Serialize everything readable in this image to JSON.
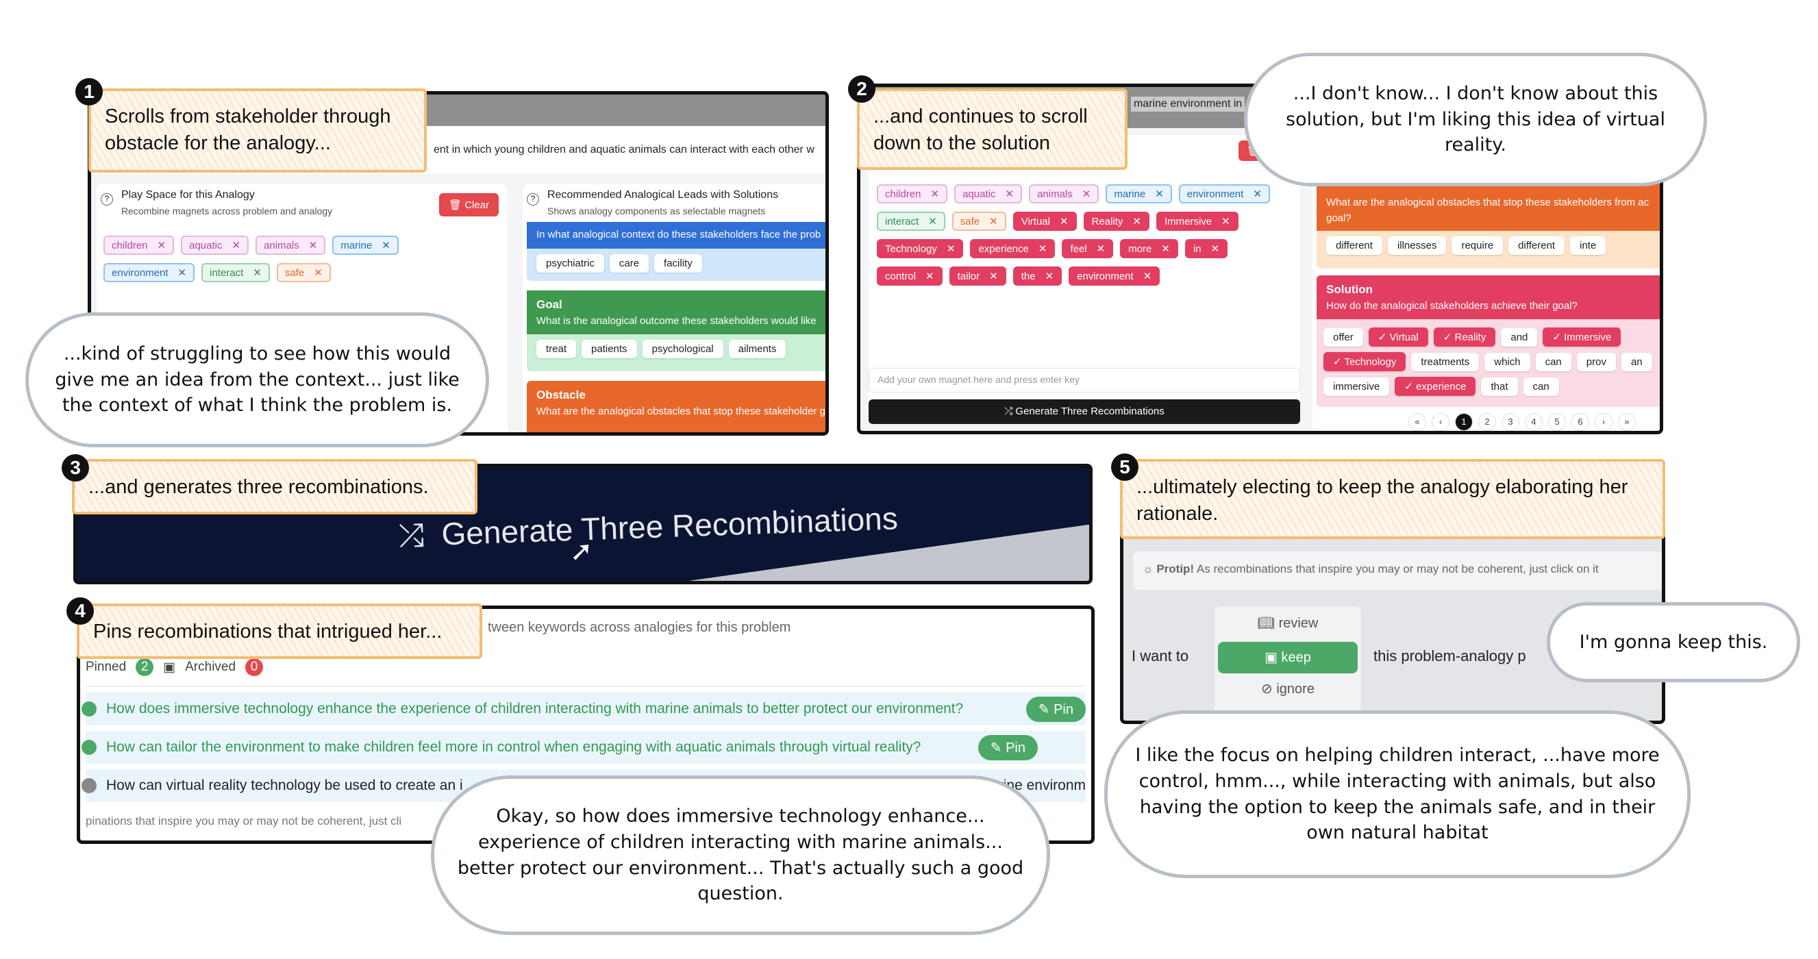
{
  "steps": [
    {
      "number": "1",
      "caption": "Scrolls from stakeholder through obstacle for the analogy..."
    },
    {
      "number": "2",
      "caption": "...and  continues to scroll down to the solution"
    },
    {
      "number": "3",
      "caption": "...and  generates three recombinations."
    },
    {
      "number": "4",
      "caption": "Pins recombinations that intrigued her..."
    },
    {
      "number": "5",
      "caption": "...ultimately electing to keep the analogy elaborating her rationale."
    }
  ],
  "quotes": {
    "q1": "...kind of struggling to see how this would give me an idea from the context... just like the context of what I think the problem is.",
    "q2": "...I don't know... I don't know about this solution, but I'm liking this idea of virtual reality.",
    "q4": "Okay, so how does immersive technology enhance... experience of children interacting with marine animals... better protect our environment... That's actually such a good question.",
    "q5a": "I'm gonna keep this.",
    "q5b": "I like the focus on helping children interact,  ...have more control, hmm..., while interacting with animals, but also having the option to keep the animals safe, and in their own natural habitat"
  },
  "panel1": {
    "problem_text": "ent in which young children and aquatic animals can interact with each other w",
    "play_space": {
      "title": "Play Space for this Analogy",
      "subtitle": "Recombine magnets across problem and analogy",
      "clear_label": "Clear",
      "tags": [
        {
          "label": "children",
          "color": "pink"
        },
        {
          "label": "aquatic",
          "color": "pink"
        },
        {
          "label": "animals",
          "color": "pink"
        },
        {
          "label": "marine",
          "color": "blue"
        },
        {
          "label": "environment",
          "color": "blue"
        },
        {
          "label": "interact",
          "color": "green"
        },
        {
          "label": "safe",
          "color": "orange"
        }
      ]
    },
    "leads": {
      "title": "Recommended Analogical Leads with Solutions",
      "subtitle": "Shows analogy components as selectable magnets",
      "context_q": "In what analogical context do these stakeholders face the prob",
      "context_chips": [
        "psychiatric",
        "care",
        "facility"
      ],
      "goal_title": "Goal",
      "goal_q": "What is the analogical outcome these stakeholders would like",
      "goal_chips": [
        "treat",
        "patients",
        "psychological",
        "ailments"
      ],
      "obstacle_title": "Obstacle",
      "obstacle_q": "What are the analogical obstacles that stop these stakeholder goal?"
    }
  },
  "panel2": {
    "problem_text": "marine environment in",
    "tags": [
      {
        "label": "children",
        "color": "pink"
      },
      {
        "label": "aquatic",
        "color": "pink"
      },
      {
        "label": "animals",
        "color": "pink"
      },
      {
        "label": "marine",
        "color": "blue"
      },
      {
        "label": "environment",
        "color": "blue"
      },
      {
        "label": "interact",
        "color": "green"
      },
      {
        "label": "safe",
        "color": "orange"
      },
      {
        "label": "Virtual",
        "color": "red"
      },
      {
        "label": "Reality",
        "color": "red"
      },
      {
        "label": "Immersive",
        "color": "red"
      },
      {
        "label": "Technology",
        "color": "red"
      },
      {
        "label": "experience",
        "color": "red"
      },
      {
        "label": "feel",
        "color": "red"
      },
      {
        "label": "more",
        "color": "red"
      },
      {
        "label": "in",
        "color": "red"
      },
      {
        "label": "control",
        "color": "red"
      },
      {
        "label": "tailor",
        "color": "red"
      },
      {
        "label": "the",
        "color": "red"
      },
      {
        "label": "environment",
        "color": "red"
      }
    ],
    "input_placeholder": "Add your own magnet here and press enter key",
    "generate_label": "Generate Three Recombinations",
    "obstacle_q": "What are the analogical obstacles that stop these stakeholders from ac goal?",
    "obstacle_chips": [
      "different",
      "illnesses",
      "require",
      "different",
      "inte"
    ],
    "solution_title": "Solution",
    "solution_q": "How do the analogical stakeholders achieve their goal?",
    "solution_chips": [
      {
        "label": "offer",
        "selected": false
      },
      {
        "label": "Virtual",
        "selected": true
      },
      {
        "label": "Reality",
        "selected": true
      },
      {
        "label": "and",
        "selected": false
      },
      {
        "label": "Immersive",
        "selected": true
      },
      {
        "label": "Technology",
        "selected": true
      },
      {
        "label": "treatments",
        "selected": false
      },
      {
        "label": "which",
        "selected": false
      },
      {
        "label": "can",
        "selected": false
      },
      {
        "label": "prov",
        "selected": false
      },
      {
        "label": "an",
        "selected": false
      },
      {
        "label": "immersive",
        "selected": false
      },
      {
        "label": "experience",
        "selected": true
      },
      {
        "label": "that",
        "selected": false
      },
      {
        "label": "can",
        "selected": false
      }
    ],
    "pagination": {
      "first": "«",
      "prev": "‹",
      "pages": [
        "1",
        "2",
        "3",
        "4",
        "5",
        "6"
      ],
      "current": "1",
      "next": "›",
      "last": "»"
    }
  },
  "panel3": {
    "button_label": "Generate Three Recombinations"
  },
  "panel4": {
    "header": "tween keywords across analogies for this problem",
    "pinned_label": "Pinned",
    "pinned_count": "2",
    "archived_label": "Archived",
    "archived_count": "0",
    "rows": [
      {
        "text": "How does immersive technology enhance the experience of children interacting with marine animals to better protect our environment?",
        "pinned": true,
        "pin_label": "Pin"
      },
      {
        "text": "How can tailor the environment to make children feel more in control when engaging with aquatic animals through virtual reality?",
        "pinned": true,
        "pin_label": "Pin"
      },
      {
        "text": "How can virtual reality technology be used to create an i",
        "tail": "rine environm",
        "pinned": false
      }
    ],
    "footer": "pinations that inspire you may or may not be coherent, just cli"
  },
  "panel5": {
    "protip_bold": "Protip!",
    "protip_text": "As recombinations that inspire you may or may not be coherent, just click on it",
    "prefix": "I want to",
    "options": [
      "review",
      "keep",
      "ignore"
    ],
    "selected": "keep",
    "suffix": "this problem-analogy p"
  },
  "colors": {
    "accent_red": "#e23e62",
    "goal_green": "#3f9a4f",
    "obstacle_orange": "#e8682c",
    "context_blue": "#2f6fd6",
    "pin_green": "#4ca866",
    "callout_border": "#f2bd74",
    "navy": "#0b1433"
  }
}
